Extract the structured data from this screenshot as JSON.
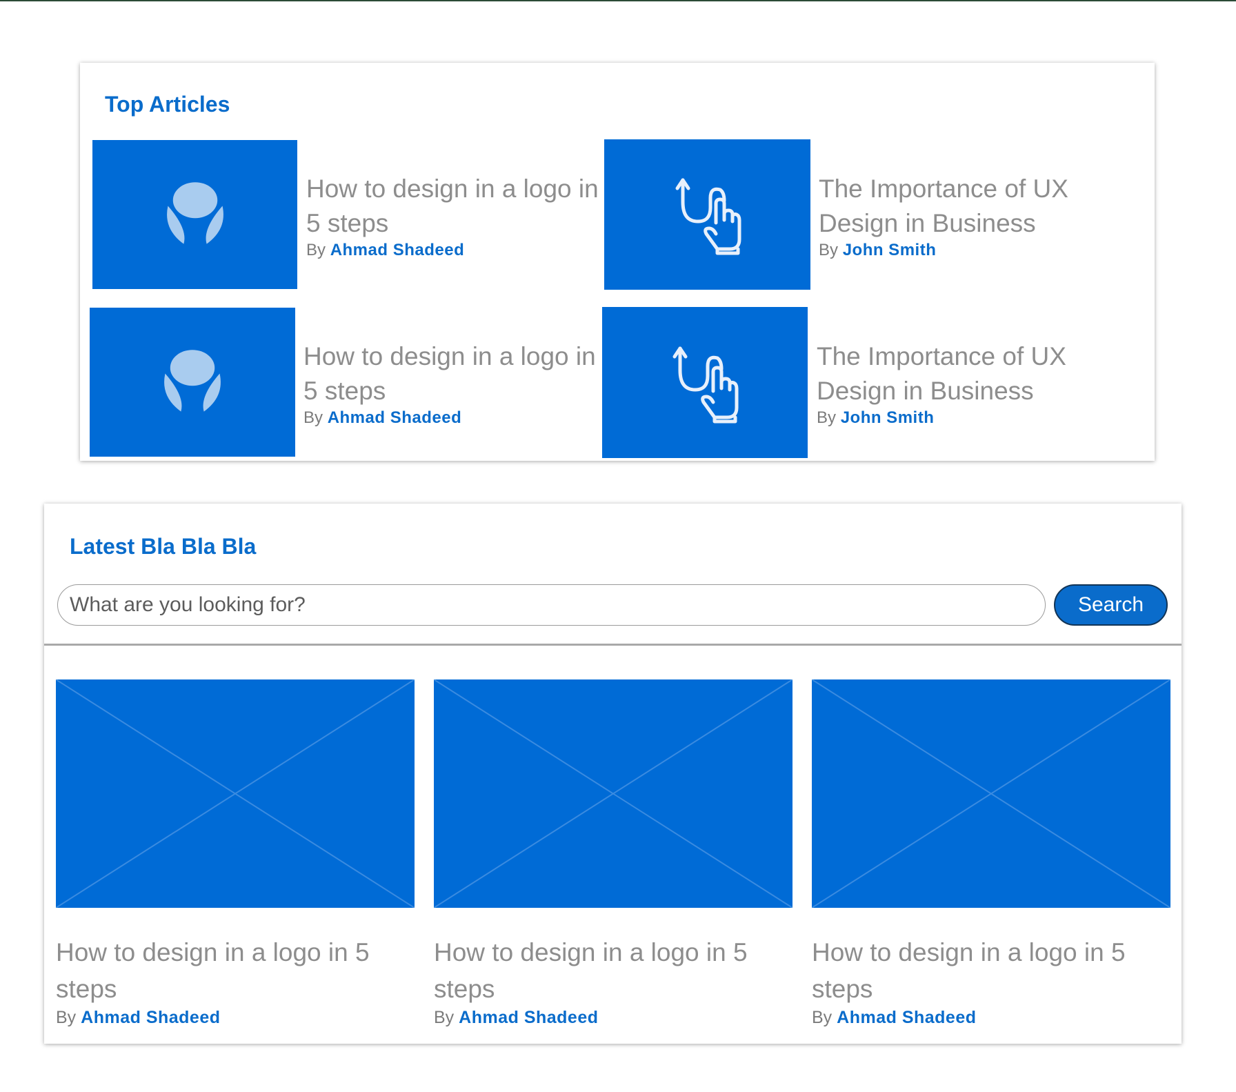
{
  "top_articles": {
    "title": "Top Articles",
    "items": [
      {
        "title": "How to design in a logo in 5 steps",
        "by": "By",
        "author": "Ahmad Shadeed",
        "icon": "logo-icon"
      },
      {
        "title": "The Importance of UX Design in Business",
        "by": "By",
        "author": "John Smith",
        "icon": "swipe-hand-icon"
      },
      {
        "title": "How to design in a logo in 5 steps",
        "by": "By",
        "author": "Ahmad Shadeed",
        "icon": "logo-icon"
      },
      {
        "title": "The Importance of UX Design in Business",
        "by": "By",
        "author": "John Smith",
        "icon": "swipe-hand-icon"
      }
    ]
  },
  "latest": {
    "title": "Latest Bla Bla Bla",
    "search": {
      "placeholder": "What are you looking for?",
      "button_label": "Search"
    },
    "items": [
      {
        "title": "How to design in a logo in 5 steps",
        "by": "By",
        "author": "Ahmad Shadeed"
      },
      {
        "title": "How to design in a logo in 5 steps",
        "by": "By",
        "author": "Ahmad Shadeed"
      },
      {
        "title": "How to design in a logo in 5 steps",
        "by": "By",
        "author": "Ahmad Shadeed"
      }
    ]
  },
  "colors": {
    "accent": "#0a6ccb",
    "thumb_blue": "#006bd6",
    "title_gray": "#8d8d8d"
  }
}
